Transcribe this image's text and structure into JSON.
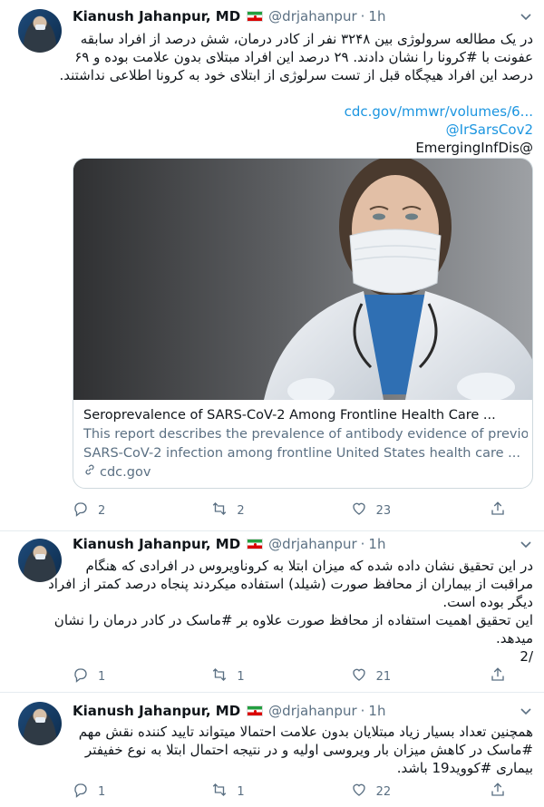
{
  "tweets": [
    {
      "author": "Kianush Jahanpur, MD",
      "handle": "@drjahanpur",
      "separator": "·",
      "time": "1h",
      "lines": [
        "در یک مطالعه سرولوژی بین ۳۲۴۸ نفر از کادر درمان، شش درصد از افراد سابقه",
        "عفونت با #کرونا را نشان دادند. ۲۹ درصد این افراد مبتلای بدون علامت بوده و ۶۹",
        "درصد این افراد هیچگاه قبل از تست سرلوژی از ابتلای خود به کرونا اطلاعی نداشتند."
      ],
      "link_lines": [
        "cdc.gov/mmwr/volumes/6...",
        "@IrSarsCov2"
      ],
      "plain_line": "EmergingInfDis@",
      "card": {
        "title": "Seroprevalence of SARS-CoV-2 Among Frontline Health Care ...",
        "desc1": "This report describes the prevalence of antibody evidence of previous",
        "desc2": "SARS-CoV-2 infection among frontline United States health care ...",
        "domain": "cdc.gov"
      },
      "replies": "2",
      "retweets": "2",
      "likes": "23"
    },
    {
      "author": "Kianush Jahanpur, MD",
      "handle": "@drjahanpur",
      "separator": "·",
      "time": "1h",
      "lines": [
        "در این تحقیق نشان داده شده که میزان ابتلا به کروناویروس در افرادی که هنگام",
        "مراقبت از بیماران از محافظ صورت (شیلد) استفاده میکردند پنجاه درصد کمتر از افراد",
        "دیگر بوده است.",
        "این تحقیق اهمیت استفاده از محافظ صورت علاوه بر #ماسک در کادر درمان را نشان",
        "میدهد.",
        "/2"
      ],
      "replies": "1",
      "retweets": "1",
      "likes": "21"
    },
    {
      "author": "Kianush Jahanpur, MD",
      "handle": "@drjahanpur",
      "separator": "·",
      "time": "1h",
      "lines": [
        "همچنین تعداد بسیار زیاد مبتلایان بدون علامت احتمالا میتواند تایید کننده نقش مهم",
        "#ماسک در کاهش میزان بار ویروسی اولیه و در نتیجه احتمال ابتلا به نوع خفیفتر",
        "بیماری #کووید19 باشد."
      ],
      "replies": "1",
      "retweets": "1",
      "likes": "22"
    }
  ],
  "colors": {
    "link": "#1b95e0",
    "muted": "#5b7083",
    "border": "#e6ecf0"
  },
  "icons": [
    "reply-icon",
    "retweet-icon",
    "like-icon",
    "share-icon",
    "chevron-down-icon",
    "link-icon",
    "iran-flag-icon"
  ]
}
